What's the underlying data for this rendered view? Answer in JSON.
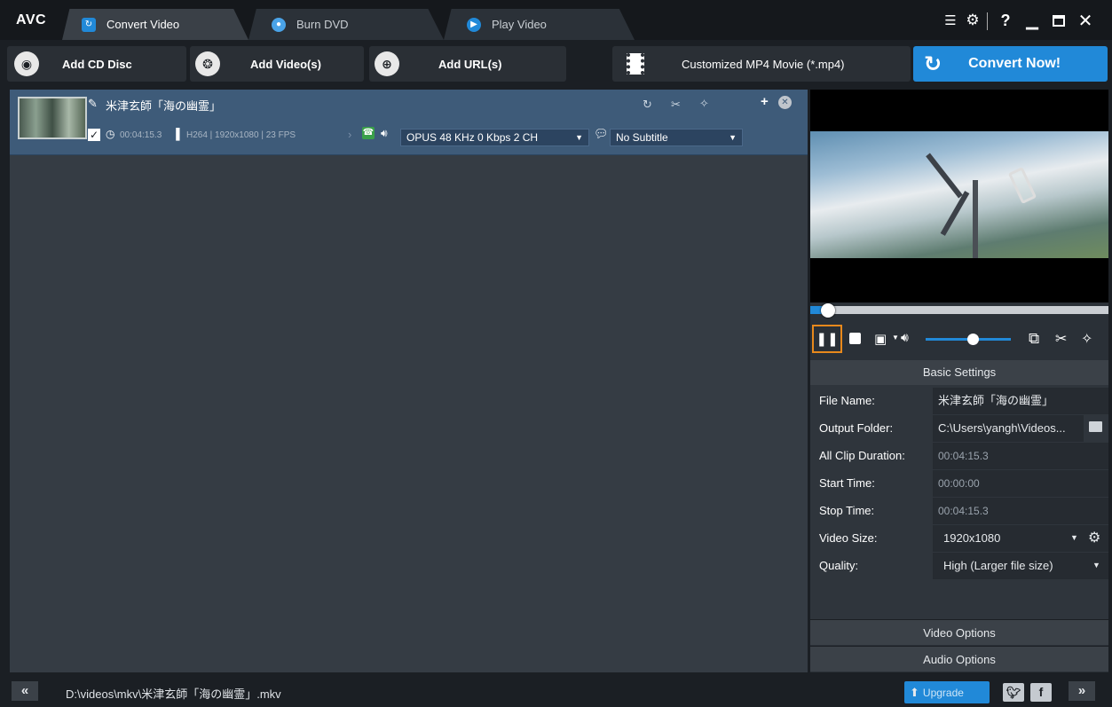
{
  "app": {
    "logo": "AVC"
  },
  "tabs": [
    {
      "label": "Convert Video",
      "active": true
    },
    {
      "label": "Burn DVD",
      "active": false
    },
    {
      "label": "Play Video",
      "active": false
    }
  ],
  "window_controls": {
    "help": "?"
  },
  "toolbar": {
    "add_cd": "Add CD Disc",
    "add_video": "Add Video(s)",
    "add_url": "Add URL(s)",
    "profile": "Customized MP4 Movie (*.mp4)",
    "convert": "Convert Now!"
  },
  "file": {
    "title": "米津玄師「海の幽霊」",
    "duration": "00:04:15.3",
    "video_info": "H264 | 1920x1080 | 23 FPS",
    "audio_track": "OPUS 48 KHz 0 Kbps 2 CH",
    "subtitle": "No Subtitle"
  },
  "player": {
    "seek_progress": 0.06,
    "volume": 0.55
  },
  "settings": {
    "header": "Basic Settings",
    "rows": [
      {
        "label": "File Name:",
        "value": "米津玄師「海の幽霊」"
      },
      {
        "label": "Output Folder:",
        "value": "C:\\Users\\yangh\\Videos..."
      },
      {
        "label": "All Clip Duration:",
        "value": "00:04:15.3"
      },
      {
        "label": "Start Time:",
        "value": "00:00:00"
      },
      {
        "label": "Stop Time:",
        "value": "00:04:15.3"
      },
      {
        "label": "Video Size:",
        "value": "1920x1080"
      },
      {
        "label": "Quality:",
        "value": "High (Larger file size)"
      }
    ],
    "video_options": "Video Options",
    "audio_options": "Audio Options"
  },
  "status": {
    "path": "D:\\videos\\mkv\\米津玄師「海の幽霊」.mkv",
    "upgrade": "Upgrade",
    "collapse": "«",
    "expand": "»"
  },
  "colors": {
    "accent": "#2189d8",
    "selected_row": "#3e5b79",
    "pause_border": "#e8891c"
  }
}
